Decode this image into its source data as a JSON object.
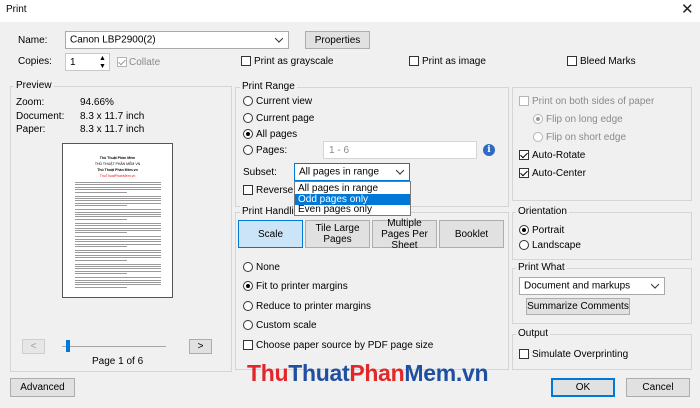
{
  "window": {
    "title": "Print",
    "close_glyph": "✕"
  },
  "printer": {
    "name_label": "Name:",
    "name_value": "Canon LBP2900(2)",
    "properties_label": "Properties"
  },
  "copies": {
    "label": "Copies:",
    "value": "1",
    "collate_label": "Collate"
  },
  "options": {
    "grayscale_label": "Print as grayscale",
    "image_label": "Print as image",
    "bleed_label": "Bleed Marks"
  },
  "preview": {
    "legend": "Preview",
    "zoom_label": "Zoom:",
    "zoom_value": "94.66%",
    "document_label": "Document:",
    "document_value": "8.3 x 11.7 inch",
    "paper_label": "Paper:",
    "paper_value": "8.3 x 11.7 inch",
    "prev_glyph": "<",
    "next_glyph": ">",
    "page_indicator": "Page 1 of 6",
    "thumb_title": "Thủ Thuật Phần Mềm",
    "thumb_subtitle": "THỦ THUẬT PHẦN MỀM VN",
    "thumb_heading": "Thủ Thuật Phần Mềm.vn",
    "thumb_brand": "ThuThuatPhanMem.vn"
  },
  "print_range": {
    "legend": "Print Range",
    "current_view_label": "Current view",
    "current_page_label": "Current page",
    "all_pages_label": "All pages",
    "pages_label": "Pages:",
    "pages_value": "1 - 6",
    "subset_label": "Subset:",
    "subset_value": "All pages in range",
    "subset_options": [
      "All pages in range",
      "Odd pages only",
      "Even pages only"
    ],
    "reverse_label": "Reverse p",
    "info_glyph": "i"
  },
  "handling": {
    "legend": "Print Handlin",
    "tabs": [
      "Scale",
      "Tile Large Pages",
      "Multiple Pages Per Sheet",
      "Booklet"
    ],
    "none_label": "None",
    "fit_label": "Fit to printer margins",
    "reduce_label": "Reduce to printer margins",
    "custom_label": "Custom scale",
    "paper_source_label": "Choose paper source by PDF page size"
  },
  "duplex": {
    "both_sides_label": "Print on both sides of paper",
    "long_edge_label": "Flip on long edge",
    "short_edge_label": "Flip on short edge",
    "auto_rotate_label": "Auto-Rotate",
    "auto_center_label": "Auto-Center"
  },
  "orientation": {
    "legend": "Orientation",
    "portrait_label": "Portrait",
    "landscape_label": "Landscape"
  },
  "print_what": {
    "legend": "Print What",
    "value": "Document and markups",
    "summarize_label": "Summarize Comments"
  },
  "output": {
    "legend": "Output",
    "simulate_label": "Simulate Overprinting"
  },
  "footer": {
    "advanced_label": "Advanced",
    "ok_label": "OK",
    "cancel_label": "Cancel"
  },
  "watermark": {
    "part1": "Thu",
    "part2": "Thuat",
    "part3": "Phan",
    "part4": "Mem",
    "part5": ".vn"
  },
  "colors": {
    "accent": "#0078d7",
    "watermark_red": "#e0282a",
    "watermark_blue": "#1f4fa0",
    "info_blue": "#2d6bc4"
  }
}
